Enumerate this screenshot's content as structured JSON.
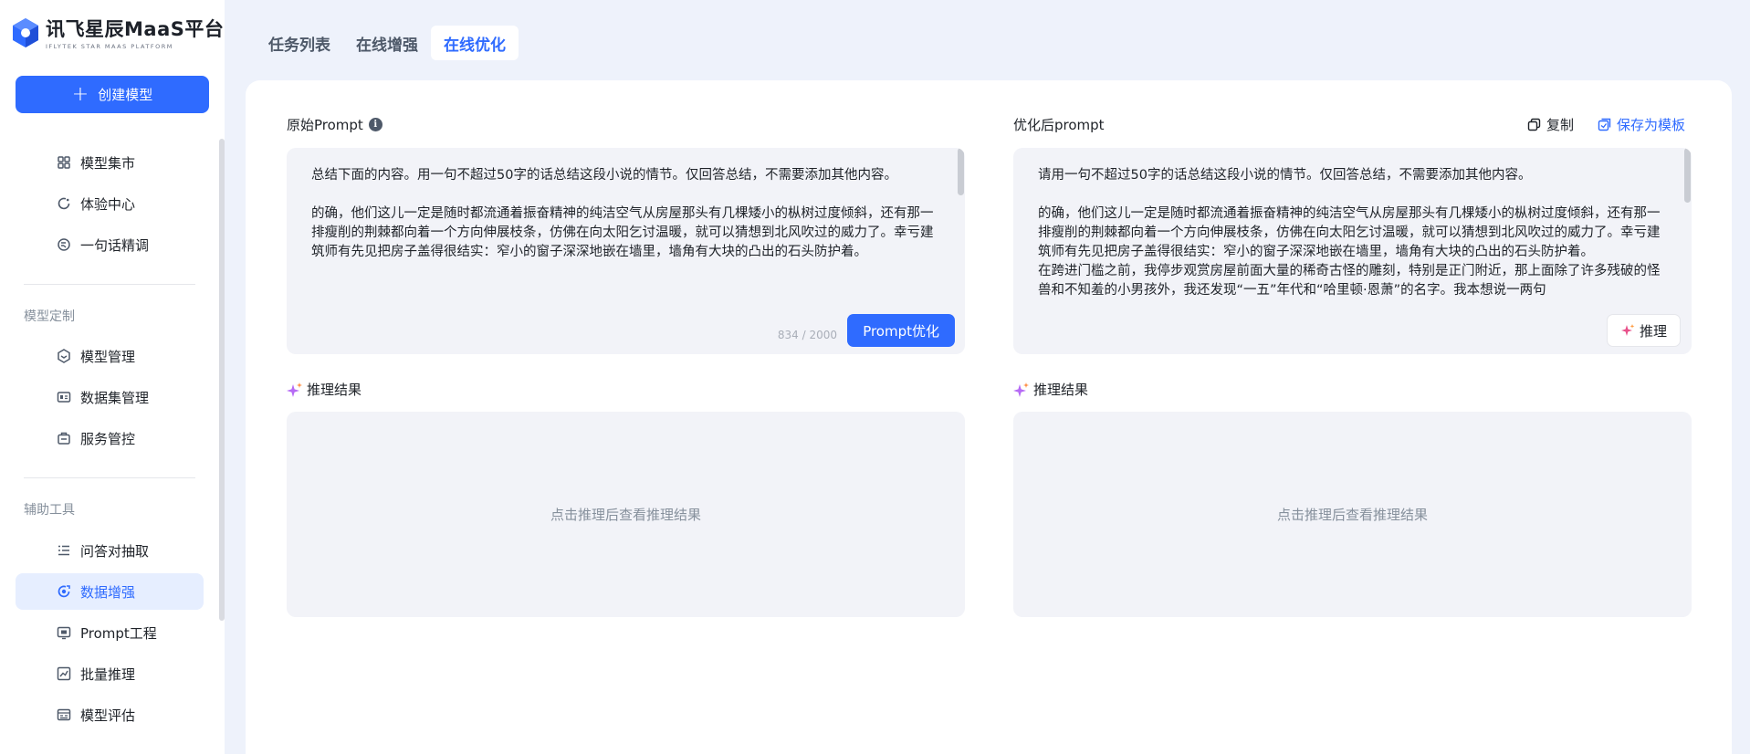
{
  "app": {
    "logo_title": "讯飞星辰MaaS平台",
    "logo_subtitle": "IFLYTEK STAR MAAS PLATFORM"
  },
  "sidebar": {
    "create_label": "创建模型",
    "items": [
      {
        "label": "模型集市",
        "icon": "grid-icon"
      },
      {
        "label": "体验中心",
        "icon": "refresh-circle-icon"
      },
      {
        "label": "一句话精调",
        "icon": "tune-circle-icon"
      }
    ],
    "section_custom": "模型定制",
    "custom_items": [
      {
        "label": "模型管理",
        "icon": "hexagon-icon"
      },
      {
        "label": "数据集管理",
        "icon": "dataset-icon"
      },
      {
        "label": "服务管控",
        "icon": "briefcase-icon"
      }
    ],
    "section_tools": "辅助工具",
    "tool_items": [
      {
        "label": "问答对抽取",
        "icon": "list-icon"
      },
      {
        "label": "数据增强",
        "icon": "boost-icon",
        "active": true
      },
      {
        "label": "Prompt工程",
        "icon": "prompt-icon"
      },
      {
        "label": "批量推理",
        "icon": "chart-icon"
      },
      {
        "label": "模型评估",
        "icon": "evaluate-icon"
      }
    ]
  },
  "tabs": [
    {
      "label": "任务列表"
    },
    {
      "label": "在线增强"
    },
    {
      "label": "在线优化",
      "active": true
    }
  ],
  "original": {
    "title": "原始Prompt",
    "text": "总结下面的内容。用一句不超过50字的话总结这段小说的情节。仅回答总结，不需要添加其他内容。\n\n的确，他们这儿一定是随时都流通着振奋精神的纯洁空气从房屋那头有几棵矮小的枞树过度倾斜，还有那一排瘦削的荆棘都向着一个方向伸展枝条，仿佛在向太阳乞讨温暖，就可以猜想到北风吹过的威力了。幸亏建筑师有先见把房子盖得很结实：窄小的窗子深深地嵌在墙里，墙角有大块的凸出的石头防护着。",
    "char_count": "834 / 2000",
    "optimize_label": "Prompt优化"
  },
  "optimized": {
    "title": "优化后prompt",
    "copy_label": "复制",
    "save_label": "保存为模板",
    "text": "请用一句不超过50字的话总结这段小说的情节。仅回答总结，不需要添加其他内容。\n\n的确，他们这儿一定是随时都流通着振奋精神的纯洁空气从房屋那头有几棵矮小的枞树过度倾斜，还有那一排瘦削的荆棘都向着一个方向伸展枝条，仿佛在向太阳乞讨温暖，就可以猜想到北风吹过的威力了。幸亏建筑师有先见把房子盖得很结实：窄小的窗子深深地嵌在墙里，墙角有大块的凸出的石头防护着。\n在跨进门槛之前，我停步观赏房屋前面大量的稀奇古怪的雕刻，特别是正门附近，那上面除了许多残破的怪兽和不知羞的小男孩外，我还发现“一五”年代和“哈里顿·恩萧”的名字。我本想说一两句",
    "infer_label": "推理"
  },
  "results": {
    "left_title": "推理结果",
    "left_placeholder": "点击推理后查看推理结果",
    "right_title": "推理结果",
    "right_placeholder": "点击推理后查看推理结果"
  },
  "colors": {
    "accent": "#2f6bff",
    "page_bg": "#eef2fb",
    "box_bg": "#f2f3f8"
  }
}
